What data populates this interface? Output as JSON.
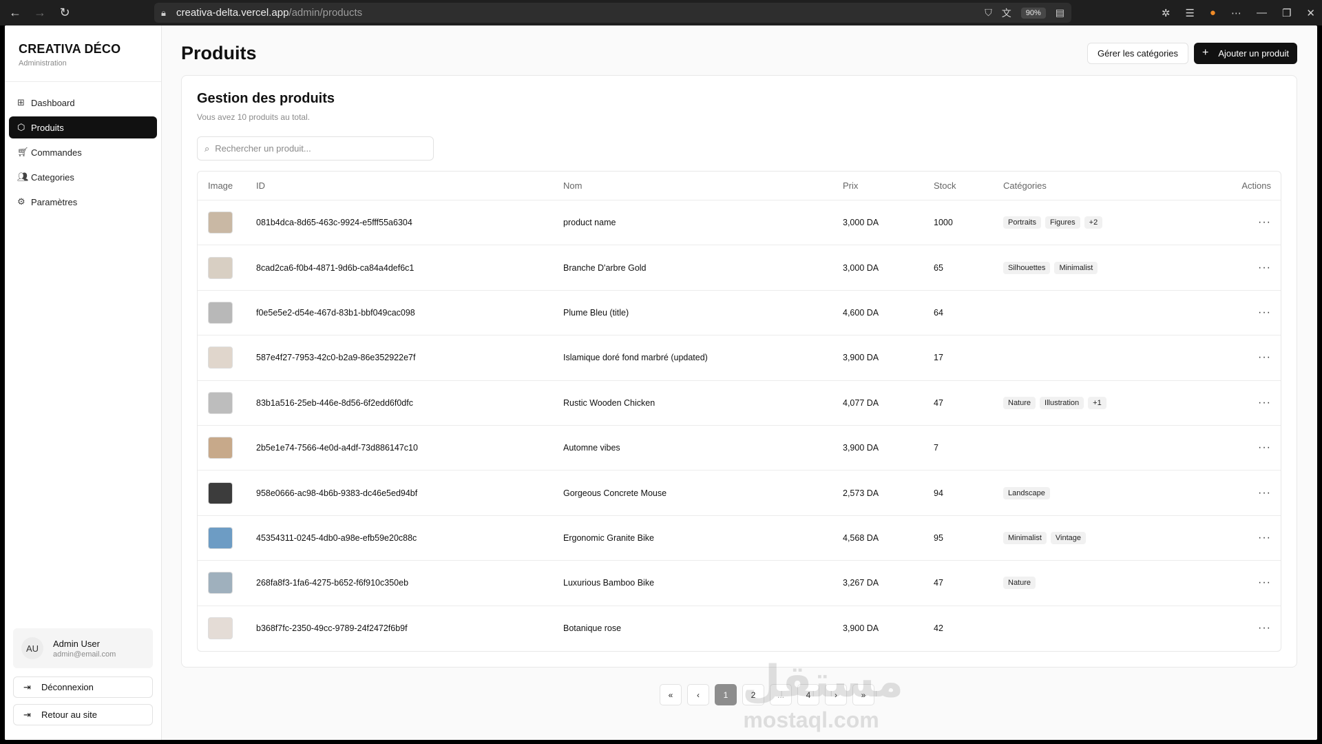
{
  "browser": {
    "url_host": "creativa-delta.vercel.app",
    "url_path": "/admin/products",
    "zoom": "90%"
  },
  "sidebar": {
    "brand_title": "CREATIVA DÉCO",
    "brand_subtitle": "Administration",
    "items": [
      {
        "label": "Dashboard",
        "icon": "grid-icon"
      },
      {
        "label": "Produits",
        "icon": "package-icon",
        "active": true
      },
      {
        "label": "Commandes",
        "icon": "cart-icon"
      },
      {
        "label": "Categories",
        "icon": "users-icon"
      },
      {
        "label": "Paramètres",
        "icon": "gear-icon"
      }
    ],
    "user": {
      "initials": "AU",
      "name": "Admin User",
      "email": "admin@email.com"
    },
    "logout_label": "Déconnexion",
    "back_label": "Retour au site"
  },
  "page": {
    "title": "Produits",
    "manage_categories_label": "Gérer les catégories",
    "add_product_label": "Ajouter un produit"
  },
  "card": {
    "title": "Gestion des produits",
    "description": "Vous avez 10 produits au total.",
    "search_placeholder": "Rechercher un produit..."
  },
  "table": {
    "headers": [
      "Image",
      "ID",
      "Nom",
      "Prix",
      "Stock",
      "Catégories",
      "Actions"
    ],
    "rows": [
      {
        "id": "081b4dca-8d65-463c-9924-e5fff55a6304",
        "name": "product name",
        "price": "3,000 DA",
        "stock": "1000",
        "categories": [
          "Portraits",
          "Figures",
          "+2"
        ],
        "thumb": "#c9b8a4"
      },
      {
        "id": "8cad2ca6-f0b4-4871-9d6b-ca84a4def6c1",
        "name": "Branche D'arbre Gold",
        "price": "3,000 DA",
        "stock": "65",
        "categories": [
          "Silhouettes",
          "Minimalist"
        ],
        "thumb": "#d8cfc3"
      },
      {
        "id": "f0e5e5e2-d54e-467d-83b1-bbf049cac098",
        "name": "Plume Bleu (title)",
        "price": "4,600 DA",
        "stock": "64",
        "categories": [],
        "thumb": "#b8b8b8"
      },
      {
        "id": "587e4f27-7953-42c0-b2a9-86e352922e7f",
        "name": "Islamique doré fond marbré (updated)",
        "price": "3,900 DA",
        "stock": "17",
        "categories": [],
        "thumb": "#e0d6cc"
      },
      {
        "id": "83b1a516-25eb-446e-8d56-6f2edd6f0dfc",
        "name": "Rustic Wooden Chicken",
        "price": "4,077 DA",
        "stock": "47",
        "categories": [
          "Nature",
          "Illustration",
          "+1"
        ],
        "thumb": "#bdbdbd"
      },
      {
        "id": "2b5e1e74-7566-4e0d-a4df-73d886147c10",
        "name": "Automne vibes",
        "price": "3,900 DA",
        "stock": "7",
        "categories": [],
        "thumb": "#c7a98a"
      },
      {
        "id": "958e0666-ac98-4b6b-9383-dc46e5ed94bf",
        "name": "Gorgeous Concrete Mouse",
        "price": "2,573 DA",
        "stock": "94",
        "categories": [
          "Landscape"
        ],
        "thumb": "#3c3c3c"
      },
      {
        "id": "45354311-0245-4db0-a98e-efb59e20c88c",
        "name": "Ergonomic Granite Bike",
        "price": "4,568 DA",
        "stock": "95",
        "categories": [
          "Minimalist",
          "Vintage"
        ],
        "thumb": "#6d9cc4"
      },
      {
        "id": "268fa8f3-1fa6-4275-b652-f6f910c350eb",
        "name": "Luxurious Bamboo Bike",
        "price": "3,267 DA",
        "stock": "47",
        "categories": [
          "Nature"
        ],
        "thumb": "#9fb0bd"
      },
      {
        "id": "b368f7fc-2350-49cc-9789-24f2472f6b9f",
        "name": "Botanique rose",
        "price": "3,900 DA",
        "stock": "42",
        "categories": [],
        "thumb": "#e4dcd6"
      }
    ]
  },
  "pagination": {
    "first": "«",
    "prev": "‹",
    "pages": [
      "1",
      "2",
      "...",
      "4"
    ],
    "current": "1",
    "next": "›",
    "last": "»"
  },
  "watermark": {
    "arabic": "مستقل",
    "latin": "mostaql.com"
  }
}
